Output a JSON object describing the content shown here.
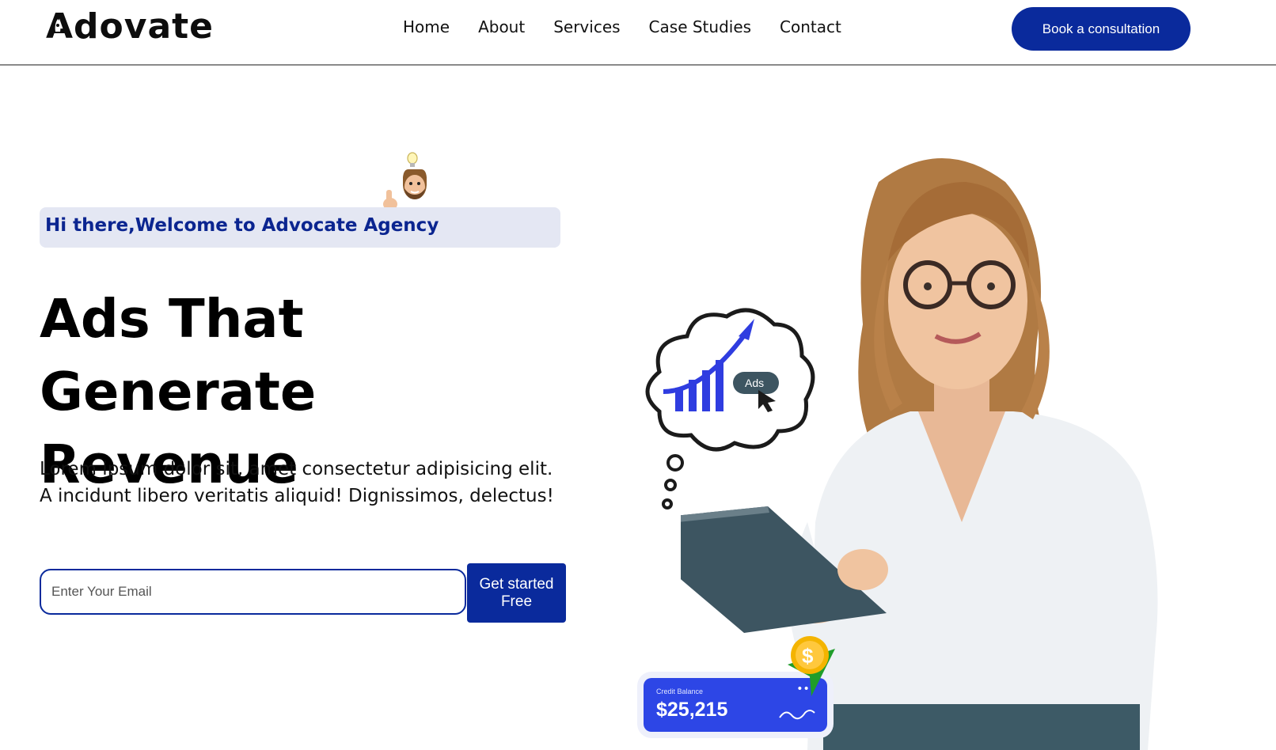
{
  "header": {
    "logo": "Adovate",
    "nav": [
      "Home",
      "About",
      "Services",
      "Case Studies",
      "Contact"
    ],
    "cta": "Book a consultation"
  },
  "hero": {
    "welcome": "Hi there,Welcome to Advocate Agency",
    "headline_line1": "Ads That Generate",
    "headline_line2": "Revenue",
    "description_line1": "Lorem ipsum dolor sit, amet consectetur adipisicing elit.",
    "description_line2": "A incidunt libero veritatis aliquid! Dignissimos, delectus!",
    "email_placeholder": "Enter Your Email",
    "start_line1": "Get started",
    "start_line2": "Free"
  },
  "illustration": {
    "thought_label": "Ads",
    "credit_label": "Credit Balance",
    "credit_value": "$25,215",
    "coin_symbol": "$"
  },
  "colors": {
    "brand": "#0a2a9c",
    "welcome_bg": "#e4e7f3",
    "card": "#2d46e6"
  }
}
